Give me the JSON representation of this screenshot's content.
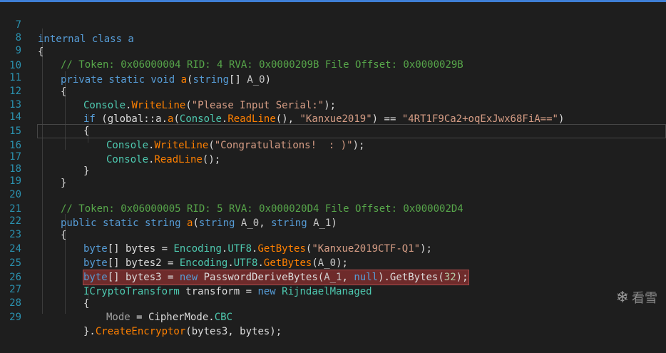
{
  "line_numbers": [
    "7",
    "8",
    "9",
    "10",
    "11",
    "12",
    "13",
    "14",
    "15",
    "16",
    "17",
    "18",
    "19",
    "20",
    "21",
    "22",
    "23",
    "24",
    "25",
    "26",
    "27",
    "28",
    "29"
  ],
  "code": {
    "l7_a": "internal class a",
    "l8_a": "{",
    "l9_a": "// Token: 0x06000004 RID: 4 RVA: 0x0000209B File Offset: 0x0000029B",
    "l10_a": "private static void ",
    "l10_b": "a",
    "l10_c": "(",
    "l10_d": "string",
    "l10_e": "[] ",
    "l10_f": "A_0",
    "l10_g": ")",
    "l11_a": "{",
    "l12_a": "Console",
    "l12_b": ".",
    "l12_c": "WriteLine",
    "l12_d": "(",
    "l12_e": "\"Please Input Serial:\"",
    "l12_f": ");",
    "l13_a": "if",
    "l13_b": " (global::a.",
    "l13_c": "a",
    "l13_d": "(",
    "l13_e": "Console",
    "l13_f": ".",
    "l13_g": "ReadLine",
    "l13_h": "(), ",
    "l13_i": "\"Kanxue2019\"",
    "l13_j": ") == ",
    "l13_k": "\"4RT1F9Ca2+oqExJwx68FiA==\"",
    "l13_l": ")",
    "l14_a": "{",
    "l15_a": "Console",
    "l15_b": ".",
    "l15_c": "WriteLine",
    "l15_d": "(",
    "l15_e": "\"Congratulations!  : )\"",
    "l15_f": ");",
    "l16_a": "Console",
    "l16_b": ".",
    "l16_c": "ReadLine",
    "l16_d": "();",
    "l17_a": "}",
    "l18_a": "}",
    "l20_a": "// Token: 0x06000005 RID: 5 RVA: 0x000020D4 File Offset: 0x000002D4",
    "l21_a": "public static string ",
    "l21_b": "a",
    "l21_c": "(",
    "l21_d": "string",
    "l21_e": " ",
    "l21_f": "A_0",
    "l21_g": ", ",
    "l21_h": "string",
    "l21_i": " ",
    "l21_j": "A_1",
    "l21_k": ")",
    "l22_a": "{",
    "l23_a": "byte",
    "l23_b": "[] bytes = ",
    "l23_c": "Encoding",
    "l23_d": ".",
    "l23_e": "UTF8",
    "l23_f": ".",
    "l23_g": "GetBytes",
    "l23_h": "(",
    "l23_i": "\"Kanxue2019CTF-Q1\"",
    "l23_j": ");",
    "l24_a": "byte",
    "l24_b": "[] bytes2 = ",
    "l24_c": "Encoding",
    "l24_d": ".",
    "l24_e": "UTF8",
    "l24_f": ".",
    "l24_g": "GetBytes",
    "l24_h": "(",
    "l24_i": "A_0",
    "l24_j": ");",
    "l25_a": "byte",
    "l25_b": "[] bytes3 = ",
    "l25_c": "new",
    "l25_d": " PasswordDeriveBytes(",
    "l25_e": "A_1",
    "l25_f": ", ",
    "l25_g": "null",
    "l25_h": ").GetBytes(",
    "l25_i": "32",
    "l25_j": ");",
    "l26_a": "ICryptoTransform",
    "l26_b": " transform = ",
    "l26_c": "new",
    "l26_d": " ",
    "l26_e": "RijndaelManaged",
    "l27_a": "{",
    "l28_a": "Mode",
    "l28_b": " = CipherMode.",
    "l28_c": "CBC",
    "l29_a": "}.",
    "l29_b": "CreateEncryptor",
    "l29_c": "(bytes3, bytes);"
  },
  "watermark": {
    "icon": "snowflake-icon",
    "glyph": "❄",
    "text": "看雪"
  },
  "colors": {
    "background": "#1e1e1e",
    "keyword": "#569cd6",
    "comment": "#57a64a",
    "type": "#4ec9b0",
    "method": "#ff8000",
    "string": "#d69d85",
    "highlight": "#6e2b2b"
  }
}
